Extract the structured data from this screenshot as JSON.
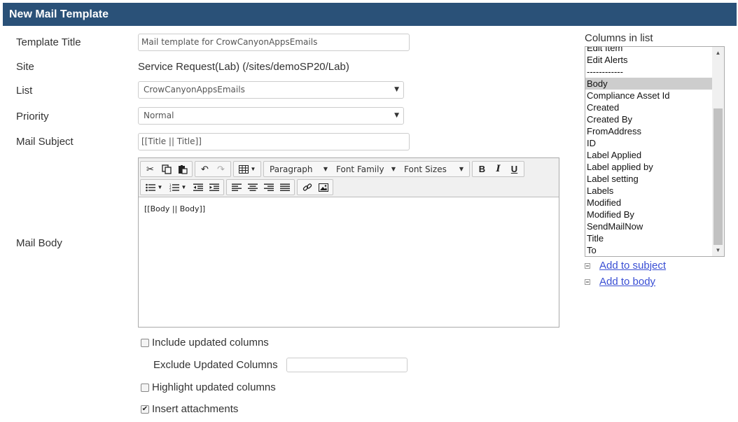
{
  "header": {
    "title": "New Mail Template"
  },
  "form": {
    "template_title_label": "Template Title",
    "template_title_value": "Mail template for CrowCanyonAppsEmails",
    "site_label": "Site",
    "site_value": "Service Request(Lab) (/sites/demoSP20/Lab)",
    "list_label": "List",
    "list_value": "CrowCanyonAppsEmails",
    "priority_label": "Priority",
    "priority_value": "Normal",
    "mail_subject_label": "Mail Subject",
    "mail_subject_value": "[[Title || Title]]",
    "mail_body_label": "Mail Body"
  },
  "editor": {
    "paragraph": "Paragraph",
    "font_family": "Font Family",
    "font_sizes": "Font Sizes",
    "bold": "B",
    "italic": "I",
    "underline": "U",
    "content": "[[Body || Body]]"
  },
  "options": {
    "include_updated": {
      "label": "Include updated columns",
      "checked": false
    },
    "exclude_updated_label": "Exclude Updated Columns",
    "exclude_updated_value": "",
    "highlight_updated": {
      "label": "Highlight updated columns",
      "checked": false
    },
    "insert_attachments": {
      "label": "Insert attachments",
      "checked": true
    }
  },
  "columns": {
    "title": "Columns in list",
    "items": [
      "Edit Item",
      "Edit Alerts",
      "------------",
      "Body",
      "Compliance Asset Id",
      "Created",
      "Created By",
      "FromAddress",
      "ID",
      "Label Applied",
      "Label applied by",
      "Label setting",
      "Labels",
      "Modified",
      "Modified By",
      "SendMailNow",
      "Title",
      "To"
    ],
    "selected": "Body",
    "add_to_subject": "Add to subject",
    "add_to_body": "Add to body"
  },
  "colors": {
    "header_bg": "#2a5178",
    "link": "#3a4fd4"
  }
}
